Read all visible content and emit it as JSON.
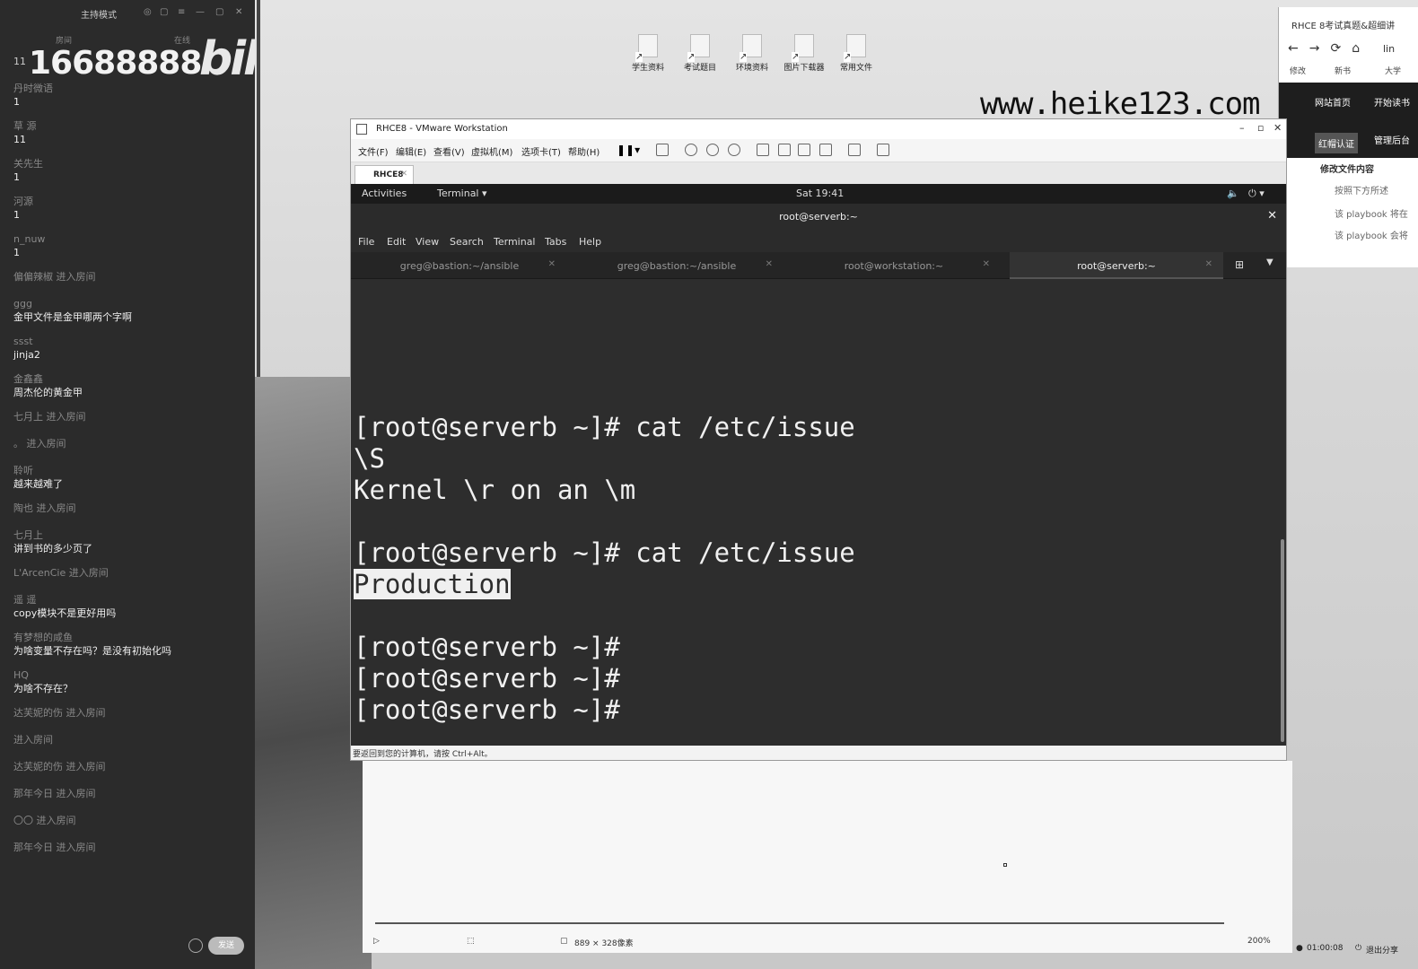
{
  "chat": {
    "mode_label": "主持模式",
    "header": [
      "房间",
      "在线"
    ],
    "room_id": "16688888",
    "room_id_small": "11",
    "logo_text": "bilibili",
    "messages": [
      {
        "user": "丹时微语",
        "text": "1"
      },
      {
        "user": "草 源",
        "text": "11"
      },
      {
        "user": "关先生",
        "text": "1"
      },
      {
        "user": "河源",
        "text": "1"
      },
      {
        "user": "n_nuw",
        "text": "1"
      },
      {
        "enter": "偏偏辣椒 进入房间"
      },
      {
        "user": "ggg",
        "text": "金甲文件是金甲哪两个字啊"
      },
      {
        "user": "ssst",
        "text": "jinja2"
      },
      {
        "user": "金鑫鑫",
        "text": "周杰伦的黄金甲"
      },
      {
        "enter": "七月上 进入房间"
      },
      {
        "enter": "。 进入房间"
      },
      {
        "user": "聆听",
        "text": "越来越难了"
      },
      {
        "enter": "陶也 进入房间"
      },
      {
        "user": "七月上",
        "text": "讲到书的多少页了"
      },
      {
        "enter": "L'ArcenCie 进入房间"
      },
      {
        "user": "遥 遥",
        "text": "copy模块不是更好用吗"
      },
      {
        "user": "有梦想的咸鱼",
        "text": "为啥变量不存在吗？是没有初始化吗"
      },
      {
        "user": "HQ",
        "text": "为啥不存在？"
      },
      {
        "enter": "达芙妮的伤 进入房间"
      },
      {
        "enter": "进入房间"
      },
      {
        "enter": "达芙妮的伤 进入房间"
      },
      {
        "enter": "那年今日 进入房间"
      },
      {
        "enter": "〇〇 进入房间"
      },
      {
        "enter": "那年今日 进入房间"
      }
    ],
    "send_label": "发送"
  },
  "desktop": {
    "icons": [
      "学生资料",
      "考试题目",
      "环境资料",
      "图片下载器",
      "常用文件"
    ],
    "watermark": "www.heike123.com"
  },
  "browser": {
    "tab_title": "RHCE 8考试真题&超细讲",
    "url": "lin",
    "bookmarks": [
      "修改",
      "新书",
      "大学"
    ],
    "nav_items": [
      "网站首页",
      "开始读书",
      "红帽认证",
      "管理后台"
    ],
    "section": "修改文件内容",
    "items": [
      "按照下方所述",
      "该 playbook 将在",
      "该 playbook 会将"
    ]
  },
  "vmware": {
    "title": "RHCE8 - VMware Workstation",
    "menus": [
      "文件(F)",
      "编辑(E)",
      "查看(V)",
      "虚拟机(M)",
      "选项卡(T)",
      "帮助(H)"
    ],
    "tab": "RHCE8",
    "status": "要返回到您的计算机，请按 Ctrl+Alt。"
  },
  "gnome": {
    "activities": "Activities",
    "app": "Terminal ▾",
    "clock": "Sat 19:41"
  },
  "terminal": {
    "title": "root@serverb:~",
    "menu": [
      "File",
      "Edit",
      "View",
      "Search",
      "Terminal",
      "Tabs",
      "Help"
    ],
    "tabs": [
      "greg@bastion:~/ansible",
      "greg@bastion:~/ansible",
      "root@workstation:~",
      "root@serverb:~"
    ],
    "lines": [
      "[root@serverb ~]# cat /etc/issue",
      "\\S",
      "Kernel \\r on an \\m",
      "",
      "[root@serverb ~]# cat /etc/issue",
      "Production",
      "",
      "[root@serverb ~]#",
      "[root@serverb ~]#",
      "[root@serverb ~]#"
    ]
  },
  "editor": {
    "selection": "889 × 328像素",
    "zoom": "200%"
  },
  "tray": {
    "time": "01:00:08",
    "share": "退出分享"
  }
}
